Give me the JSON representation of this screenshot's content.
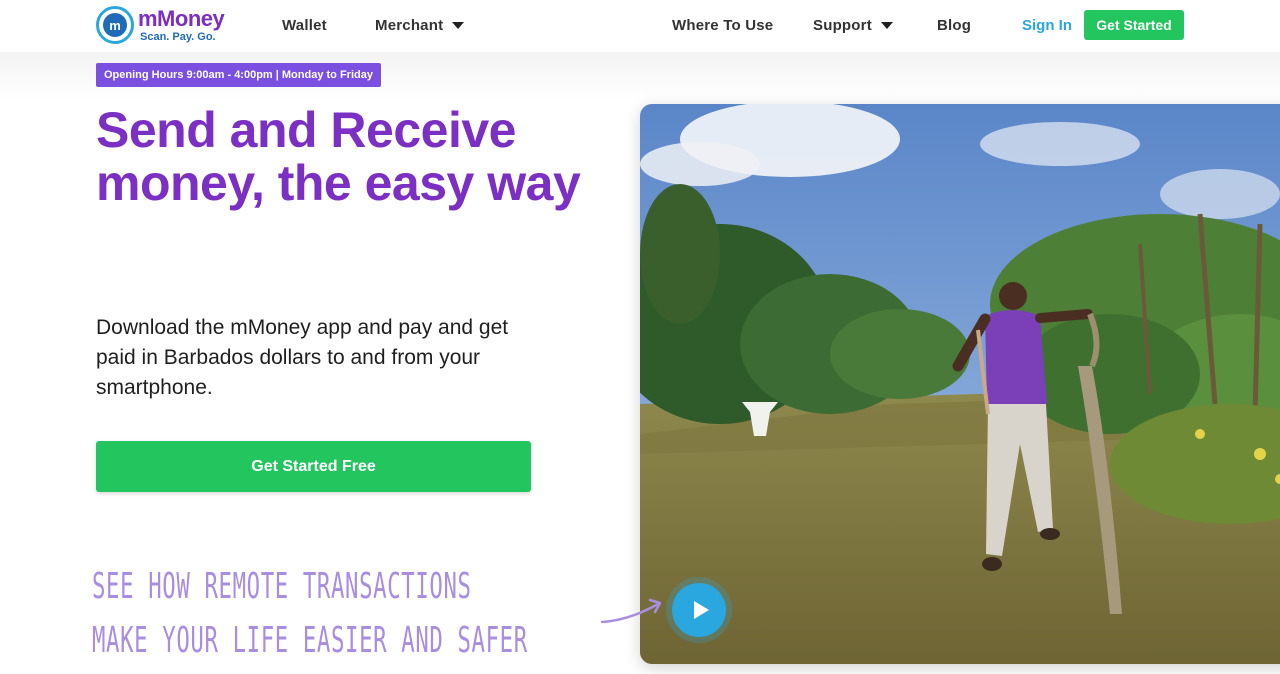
{
  "brand": {
    "name": "mMoney",
    "tagline": "Scan. Pay. Go.",
    "mark": "m",
    "colors": {
      "purple": "#7b2fc3",
      "blue": "#2aa7de",
      "green": "#22c55e"
    }
  },
  "nav": {
    "wallet": "Wallet",
    "merchant": "Merchant",
    "where_to_use": "Where To Use",
    "support": "Support",
    "blog": "Blog",
    "sign_in": "Sign In",
    "get_started": "Get Started"
  },
  "hero": {
    "hours": "Opening Hours 9:00am - 4:00pm | Monday to Friday",
    "headline": "Send and Receive money, the easy way",
    "subtext": "Download the mMoney app and pay and get paid in Barbados dollars to and from your smartphone.",
    "cta": "Get Started Free",
    "video_caption_line1": "See how remote transactions",
    "video_caption_line2": "make your life easier and safer"
  },
  "icons": {
    "merchant_caret": "chevron-down-icon",
    "support_caret": "chevron-down-icon",
    "play": "play-icon",
    "arrow": "arrow-icon"
  }
}
